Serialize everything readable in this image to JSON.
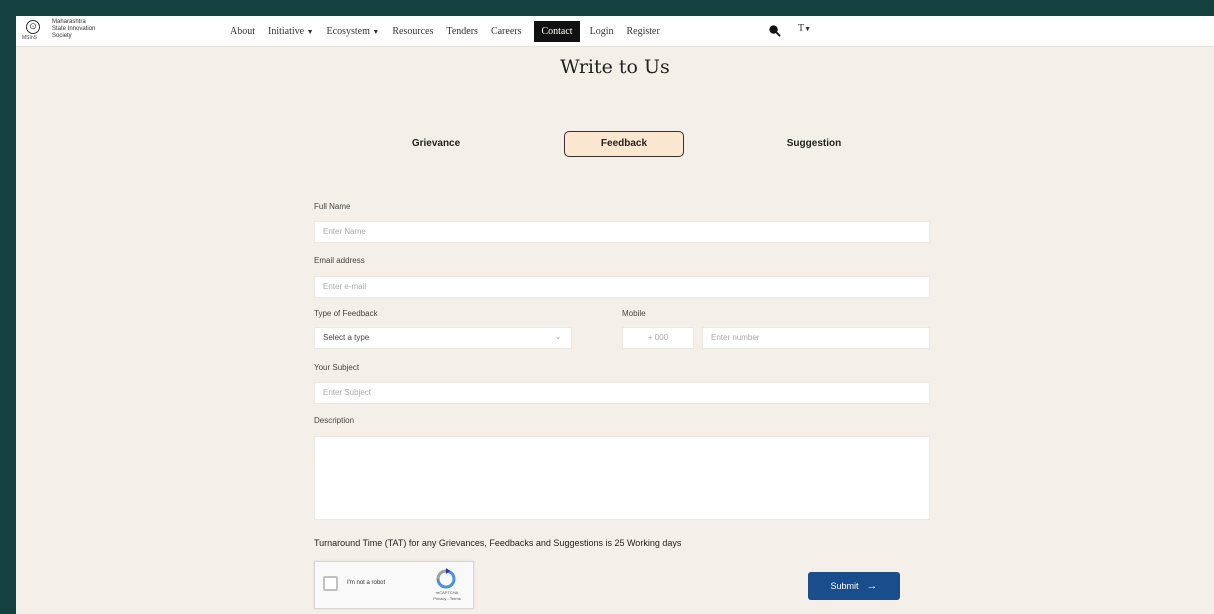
{
  "org": {
    "name_lines": [
      "Maharashtra",
      "State Innovation",
      "Society"
    ],
    "logo_sub": "MSInS"
  },
  "nav": {
    "items": [
      {
        "label": "About",
        "caret": ""
      },
      {
        "label": "Initiative",
        "caret": "▼"
      },
      {
        "label": "Ecosystem",
        "caret": "▼"
      },
      {
        "label": "Resources",
        "caret": ""
      },
      {
        "label": "Tenders",
        "caret": ""
      },
      {
        "label": "Careers",
        "caret": ""
      },
      {
        "label": "Contact",
        "caret": ""
      },
      {
        "label": "Login",
        "caret": ""
      },
      {
        "label": "Register",
        "caret": ""
      }
    ],
    "active": "Contact",
    "lang_label": "T",
    "lang_caret": "▼"
  },
  "page": {
    "title": "Write to Us"
  },
  "tabs": {
    "grievance": "Grievance",
    "feedback": "Feedback",
    "suggestion": "Suggestion",
    "selected": "Feedback"
  },
  "form": {
    "full_name": {
      "label": "Full Name",
      "placeholder": "Enter Name"
    },
    "email": {
      "label": "Email address",
      "placeholder": "Enter e-mail"
    },
    "type": {
      "label": "Type of Feedback",
      "value": "Select a type"
    },
    "mobile": {
      "label": "Mobile",
      "country_code": "+ 000",
      "placeholder": "Enter number"
    },
    "subject": {
      "label": "Your Subject",
      "placeholder": "Enter Subject"
    },
    "description": {
      "label": "Description"
    },
    "tat_note": "Turnaround Time (TAT) for any Grievances, Feedbacks and Suggestions is 25 Working days",
    "captcha": {
      "text": "I'm not a robot",
      "brand": "reCAPTCHA",
      "links": "Privacy - Terms"
    },
    "submit_label": "Submit",
    "submit_arrow": "→"
  },
  "colors": {
    "background": "#14403f",
    "page": "#f4efe8",
    "active_tab": "#fbe7d0",
    "submit": "#1a4d8c",
    "nav_active": "#111111"
  }
}
